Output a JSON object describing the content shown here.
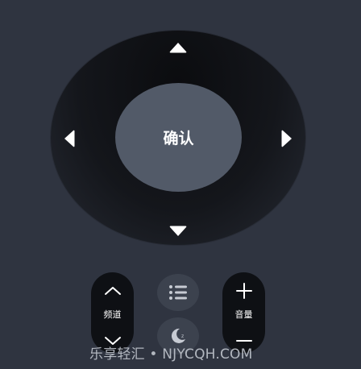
{
  "dpad": {
    "ok_label": "确认",
    "up_icon": "arrow-up-icon",
    "down_icon": "arrow-down-icon",
    "left_icon": "arrow-left-icon",
    "right_icon": "arrow-right-icon"
  },
  "channel": {
    "label": "频道",
    "up_icon": "chevron-up-icon",
    "down_icon": "chevron-down-icon"
  },
  "volume": {
    "label": "音量",
    "up_icon": "plus-icon",
    "down_icon": "minus-icon"
  },
  "menu": {
    "icon": "list-icon"
  },
  "sleep": {
    "icon": "moon-icon"
  },
  "watermark": {
    "text": "乐享轻汇 • NJYCQH.COM"
  },
  "colors": {
    "background": "#2f3440",
    "dpad_dark": "#0b0c0f",
    "ok_button": "#525a68",
    "pill": "#0e1014",
    "round_button": "#3c424e",
    "icon": "#ffffff"
  }
}
